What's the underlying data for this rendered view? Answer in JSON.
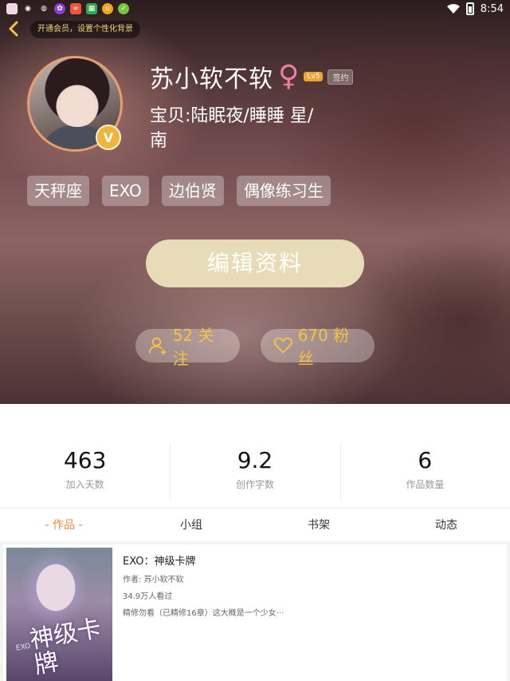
{
  "statusbar": {
    "time": "8:54"
  },
  "header": {
    "vip_text": "开通会员，设置个性化背景",
    "username": "苏小软不软",
    "gender_symbol": "♀",
    "level": "Lv5",
    "signed": "签约",
    "verified_badge": "V",
    "bio": "宝贝:陆眠夜/睡睡 星/南",
    "tags": [
      "天秤座",
      "EXO",
      "边伯贤",
      "偶像练习生"
    ],
    "edit_button": "编辑资料",
    "follow_label": "52 关注",
    "fans_label": "670 粉丝"
  },
  "stats": [
    {
      "value": "463",
      "label": "加入天数"
    },
    {
      "value": "9.2",
      "label": "创作字数"
    },
    {
      "value": "6",
      "label": "作品数量"
    }
  ],
  "tabs": [
    "- 作品 -",
    "小组",
    "书架",
    "动态"
  ],
  "work": {
    "title": "EXO：神级卡牌",
    "author": "作者: 苏小软不软",
    "views": "34.9万人看过",
    "desc": "精修勿看（已精修16章）这大概是一个少女···",
    "cover_text": "神级卡牌",
    "cover_sub": "EXO"
  },
  "colors": {
    "accent": "#f3c344",
    "tab_active": "#f08a3a",
    "gender": "#f07f9c"
  }
}
